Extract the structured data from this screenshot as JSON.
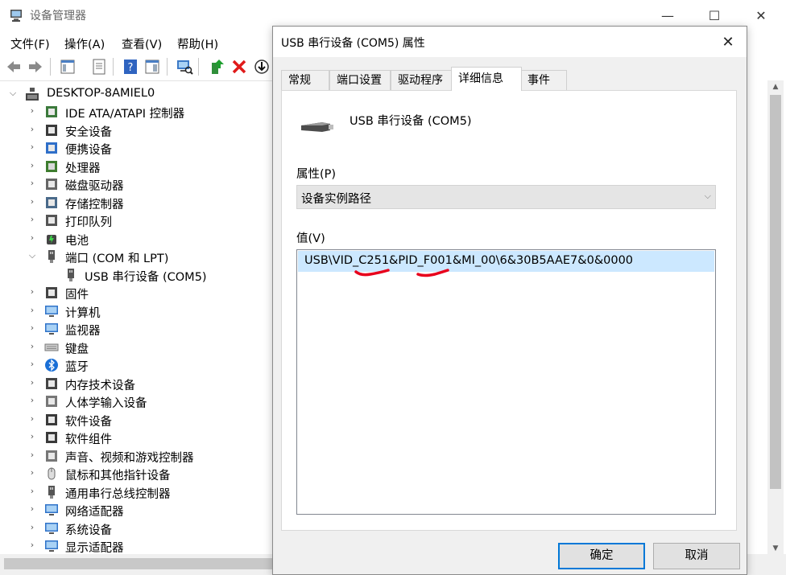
{
  "main_window": {
    "title": "设备管理器",
    "controls": {
      "minimize": "—",
      "maximize": "☐",
      "close": "✕"
    },
    "menu": [
      "文件(F)",
      "操作(A)",
      "查看(V)",
      "帮助(H)"
    ],
    "tree": {
      "root": "DESKTOP-8AMIEL0",
      "items": [
        {
          "label": "IDE ATA/ATAPI 控制器",
          "icon": "ide-controller-icon",
          "expanded": false
        },
        {
          "label": "安全设备",
          "icon": "security-device-icon",
          "expanded": false
        },
        {
          "label": "便携设备",
          "icon": "portable-device-icon",
          "expanded": false
        },
        {
          "label": "处理器",
          "icon": "processor-icon",
          "expanded": false
        },
        {
          "label": "磁盘驱动器",
          "icon": "disk-drive-icon",
          "expanded": false
        },
        {
          "label": "存储控制器",
          "icon": "storage-controller-icon",
          "expanded": false
        },
        {
          "label": "打印队列",
          "icon": "print-queue-icon",
          "expanded": false
        },
        {
          "label": "电池",
          "icon": "battery-icon",
          "expanded": false
        },
        {
          "label": "端口 (COM 和 LPT)",
          "icon": "port-icon",
          "expanded": true
        },
        {
          "label": "USB 串行设备 (COM5)",
          "icon": "usb-serial-icon",
          "child": true
        },
        {
          "label": "固件",
          "icon": "firmware-icon",
          "expanded": false
        },
        {
          "label": "计算机",
          "icon": "computer-icon",
          "expanded": false
        },
        {
          "label": "监视器",
          "icon": "monitor-icon",
          "expanded": false
        },
        {
          "label": "键盘",
          "icon": "keyboard-icon",
          "expanded": false
        },
        {
          "label": "蓝牙",
          "icon": "bluetooth-icon",
          "expanded": false
        },
        {
          "label": "内存技术设备",
          "icon": "memory-device-icon",
          "expanded": false
        },
        {
          "label": "人体学输入设备",
          "icon": "hid-icon",
          "expanded": false
        },
        {
          "label": "软件设备",
          "icon": "software-device-icon",
          "expanded": false
        },
        {
          "label": "软件组件",
          "icon": "software-component-icon",
          "expanded": false
        },
        {
          "label": "声音、视频和游戏控制器",
          "icon": "sound-icon",
          "expanded": false
        },
        {
          "label": "鼠标和其他指针设备",
          "icon": "mouse-icon",
          "expanded": false
        },
        {
          "label": "通用串行总线控制器",
          "icon": "usb-controller-icon",
          "expanded": false
        },
        {
          "label": "网络适配器",
          "icon": "network-adapter-icon",
          "expanded": false
        },
        {
          "label": "系统设备",
          "icon": "system-device-icon",
          "expanded": false
        },
        {
          "label": "显示适配器",
          "icon": "display-adapter-icon",
          "expanded": false
        }
      ]
    }
  },
  "dialog": {
    "title": "USB 串行设备 (COM5) 属性",
    "close": "✕",
    "tabs": [
      "常规",
      "端口设置",
      "驱动程序",
      "详细信息",
      "事件"
    ],
    "active_tab": "详细信息",
    "device_name": "USB 串行设备 (COM5)",
    "property_label": "属性(P)",
    "property_value": "设备实例路径",
    "value_label": "值(V)",
    "value_text": "USB\\VID_C251&PID_F001&MI_00\\6&30B5AAE7&0&0000",
    "ok": "确定",
    "cancel": "取消",
    "annotation_color": "#e8001c"
  }
}
